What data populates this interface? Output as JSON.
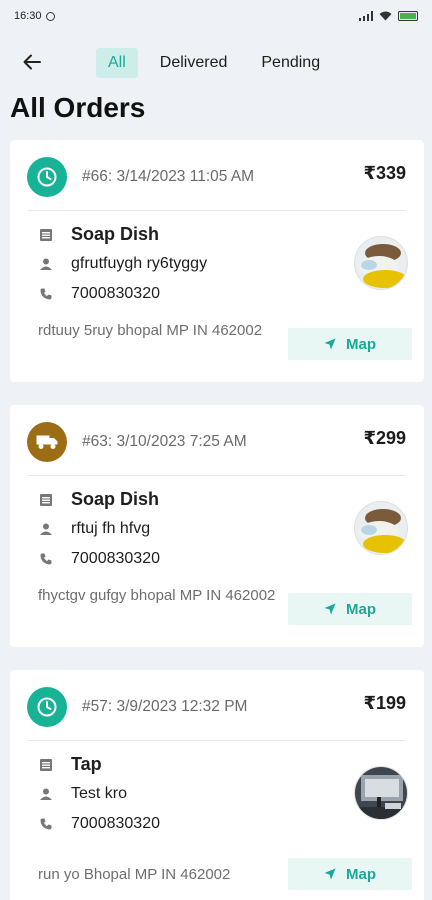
{
  "statusbar": {
    "time": "16:30"
  },
  "nav": {
    "tabs": [
      {
        "label": "All"
      },
      {
        "label": "Delivered"
      },
      {
        "label": "Pending"
      }
    ]
  },
  "page": {
    "title": "All Orders"
  },
  "colors": {
    "accent": "#1aa898",
    "status_pending": "#18b297",
    "status_shipping": "#9c6d14"
  },
  "orders": [
    {
      "status_icon": "clock-icon",
      "meta": "#66: 3/14/2023 11:05 AM",
      "price": "₹339",
      "product": "Soap Dish",
      "customer": "gfrutfuygh ry6tyggy",
      "phone": "7000830320",
      "address": "rdtuuy 5ruy bhopal MP IN 462002",
      "map_label": "Map"
    },
    {
      "status_icon": "truck-icon",
      "meta": "#63: 3/10/2023 7:25 AM",
      "price": "₹299",
      "product": "Soap Dish",
      "customer": "rftuj fh hfvg",
      "phone": "7000830320",
      "address": "fhyctgv gufgy bhopal MP IN 462002",
      "map_label": "Map"
    },
    {
      "status_icon": "clock-icon",
      "meta": "#57: 3/9/2023 12:32 PM",
      "price": "₹199",
      "product": "Tap",
      "customer": "Test kro",
      "phone": "7000830320",
      "address": "run yo Bhopal MP IN 462002",
      "map_label": "Map"
    }
  ]
}
